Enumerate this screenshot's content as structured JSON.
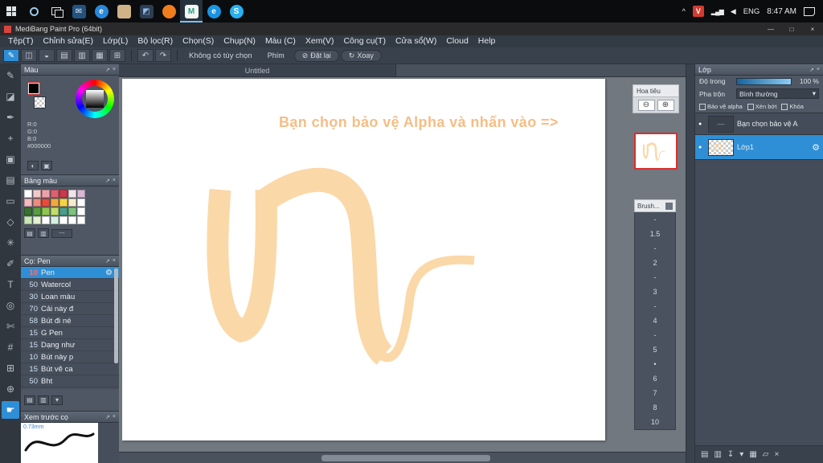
{
  "theme": {
    "accent": "#2e8fd6",
    "viewport_red": "#d92f2f"
  },
  "taskbar": {
    "time": "8:47 AM",
    "language": "ENG",
    "tray": {
      "chevron": "^",
      "badge": "V",
      "network": "▂▄▆",
      "volume": "◀"
    },
    "apps": [
      {
        "name": "mail",
        "glyph": "✉",
        "bg": "#24527e",
        "fg": "#dbe7f3",
        "shape": "square",
        "active": false
      },
      {
        "name": "browser-e",
        "glyph": "e",
        "bg": "#2a88d8",
        "fg": "#ffffff",
        "shape": "circle",
        "active": false
      },
      {
        "name": "file-explorer",
        "glyph": "",
        "bg": "#cfb288",
        "fg": "#ffffff",
        "shape": "square",
        "active": false
      },
      {
        "name": "photos",
        "glyph": "◩",
        "bg": "#2c3e53",
        "fg": "#92b9e2",
        "shape": "square",
        "active": false
      },
      {
        "name": "firefox",
        "glyph": "",
        "bg": "#f07d1d",
        "fg": "#ffffff",
        "shape": "circle",
        "active": false
      },
      {
        "name": "medibang-paint",
        "glyph": "M",
        "bg": "#f3f6f3",
        "fg": "#2f9f8e",
        "shape": "square",
        "active": true
      },
      {
        "name": "edge",
        "glyph": "e",
        "bg": "#1b94e0",
        "fg": "#ffffff",
        "shape": "circle",
        "active": false
      },
      {
        "name": "skype",
        "glyph": "S",
        "bg": "#28b1f1",
        "fg": "#ffffff",
        "shape": "circle",
        "active": false
      }
    ]
  },
  "window": {
    "title": "MediBang Paint Pro (64bit)",
    "minimize": "—",
    "maximize": "□",
    "close": "×"
  },
  "menubar": {
    "items": [
      "Tệp(T)",
      "Chỉnh sửa(E)",
      "Lớp(L)",
      "Bộ lọc(R)",
      "Chọn(S)",
      "Chụp(N)",
      "Màu (C)",
      "Xem(V)",
      "Công cụ(T)",
      "Cửa sổ(W)",
      "Cloud",
      "Help"
    ]
  },
  "toolbar": {
    "icons": [
      {
        "name": "brush-options",
        "glyph": "✎",
        "active": true
      },
      {
        "name": "save",
        "glyph": "◫",
        "active": false
      },
      {
        "name": "comment",
        "glyph": "◒",
        "active": false
      },
      {
        "name": "layout-left",
        "glyph": "▤",
        "active": false
      },
      {
        "name": "layout-both",
        "glyph": "▥",
        "active": false
      },
      {
        "name": "layout-right",
        "glyph": "▦",
        "active": false
      },
      {
        "name": "grid",
        "glyph": "⊞",
        "active": false
      }
    ],
    "undo_icon": "↶",
    "redo_icon": "↷",
    "no_option_text": "Không có tùy chọn",
    "key_button": "Phím",
    "reset_icon": "⊘",
    "reset_button": "Đặt lại",
    "rotate_icon": "↻",
    "rotate_button": "Xoay"
  },
  "document_tab": {
    "title": "Untitled"
  },
  "tools": [
    {
      "name": "brush-tool",
      "glyph": "✎",
      "selected": false
    },
    {
      "name": "eraser-tool",
      "glyph": "◪",
      "selected": false
    },
    {
      "name": "pen-tool",
      "glyph": "✒",
      "selected": false
    },
    {
      "name": "move-tool",
      "glyph": "+",
      "selected": false
    },
    {
      "name": "fill-tool",
      "glyph": "▣",
      "selected": false
    },
    {
      "name": "gradient-tool",
      "glyph": "▤",
      "selected": false
    },
    {
      "name": "select-rect-tool",
      "glyph": "▭",
      "selected": false
    },
    {
      "name": "lasso-tool",
      "glyph": "◇",
      "selected": false
    },
    {
      "name": "magic-wand-tool",
      "glyph": "✳",
      "selected": false
    },
    {
      "name": "select-pen-tool",
      "glyph": "✐",
      "selected": false
    },
    {
      "name": "text-tool",
      "glyph": "T",
      "selected": false
    },
    {
      "name": "eyedropper-tool",
      "glyph": "◎",
      "selected": false
    },
    {
      "name": "scissors-tool",
      "glyph": "✄",
      "selected": false
    },
    {
      "name": "divide-tool",
      "glyph": "#",
      "selected": false
    },
    {
      "name": "grid-tool",
      "glyph": "⊞",
      "selected": false
    },
    {
      "name": "zoom-tool",
      "glyph": "⊕",
      "selected": false
    },
    {
      "name": "hand-tool",
      "glyph": "☛",
      "selected": true
    }
  ],
  "color_panel": {
    "title": "Màu",
    "r": "R:0",
    "g": "G:0",
    "b": "B:0",
    "hex": "#000000",
    "buttons": [
      {
        "name": "palette-mode",
        "glyph": "◐"
      },
      {
        "name": "picker-mode",
        "glyph": "▣"
      }
    ]
  },
  "palette_panel": {
    "title": "Bảng màu",
    "menu_text": "---",
    "buttons": [
      {
        "name": "add-swatch",
        "glyph": "▤"
      },
      {
        "name": "delete-swatch",
        "glyph": "▥"
      }
    ],
    "swatches": [
      "#ffffff",
      "#f2c9c9",
      "#eba3ab",
      "#e06070",
      "#c93a4e",
      "#f0e3ea",
      "#d9b8d3",
      "#f5b9c0",
      "#ef8a7a",
      "#e84b3c",
      "#f2a93b",
      "#f5d245",
      "#f7ecc8",
      "#ffffff",
      "#39702f",
      "#579e41",
      "#8fc653",
      "#c2dd6a",
      "#4a9e90",
      "#7cc47e",
      "#ffffff",
      "#c8e8b4",
      "#e2f2d2",
      "#ffffff",
      "#d6efe0",
      "#ffffff",
      "#ffffff",
      "#ffffff"
    ]
  },
  "brush_panel": {
    "title": "Cọ: Pen",
    "buttons": [
      {
        "name": "add-brush",
        "glyph": "▤"
      },
      {
        "name": "delete-brush",
        "glyph": "▥"
      },
      {
        "name": "brush-menu",
        "glyph": "▾"
      }
    ],
    "brushes": [
      {
        "size": "10",
        "name": "Pen",
        "selected": true
      },
      {
        "size": "50",
        "name": "Watercol",
        "selected": false
      },
      {
        "size": "30",
        "name": "Loan màu",
        "selected": false
      },
      {
        "size": "70",
        "name": "Cải này đ",
        "selected": false
      },
      {
        "size": "58",
        "name": "Bút đi né",
        "selected": false
      },
      {
        "size": "15",
        "name": "G Pen",
        "selected": false
      },
      {
        "size": "15",
        "name": "Dạng như",
        "selected": false
      },
      {
        "size": "10",
        "name": "Bút này p",
        "selected": false
      },
      {
        "size": "15",
        "name": "Bút vẽ ca",
        "selected": false
      },
      {
        "size": "50",
        "name": "Bht",
        "selected": false
      }
    ]
  },
  "preview_panel": {
    "title": "Xem trước cọ",
    "size": "0.73mm"
  },
  "canvas": {
    "hint_text": "Bạn chọn bảo vệ Alpha và nhấn vào =>",
    "ink_color": "#fbd8a8",
    "text_color": "#f6bd85"
  },
  "navigator": {
    "title": "Hoa tiêu",
    "zoom_out": "⊖",
    "zoom_in": "⊕"
  },
  "brush_size_panel": {
    "title": "Brush...",
    "values": [
      "-",
      "1.5",
      "-",
      "2",
      "-",
      "3",
      "-",
      "4",
      "-",
      "5",
      "•",
      "6",
      "7",
      "8",
      "10"
    ]
  },
  "layers_panel": {
    "title": "Lớp",
    "opacity_label": "Độ trong",
    "opacity_value": "100 %",
    "blend_label": "Pha trộn",
    "blend_value": "Bình thường",
    "dropdown_arrow": "▾",
    "options": [
      {
        "name": "protect-alpha-checkbox",
        "label": "Bảo vệ alpha"
      },
      {
        "name": "clipping-checkbox",
        "label": "Xén bớt"
      },
      {
        "name": "lock-checkbox",
        "label": "Khóa"
      }
    ],
    "layers": [
      {
        "name": "Bạn chọn bảo vệ A",
        "thumb": "text",
        "selected": false
      },
      {
        "name": "Lớp1",
        "thumb": "art",
        "selected": true
      }
    ],
    "buttons": [
      {
        "name": "new-layer-button",
        "glyph": "▤"
      },
      {
        "name": "duplicate-layer-button",
        "glyph": "▥"
      },
      {
        "name": "transfer-layer-button",
        "glyph": "↧"
      },
      {
        "name": "merge-layer-button",
        "glyph": "▾"
      },
      {
        "name": "material-button",
        "glyph": "▦"
      },
      {
        "name": "folder-button",
        "glyph": "▱"
      },
      {
        "name": "delete-layer-button",
        "glyph": "×"
      }
    ]
  },
  "panel_icons": {
    "float": "↗",
    "close": "×"
  }
}
